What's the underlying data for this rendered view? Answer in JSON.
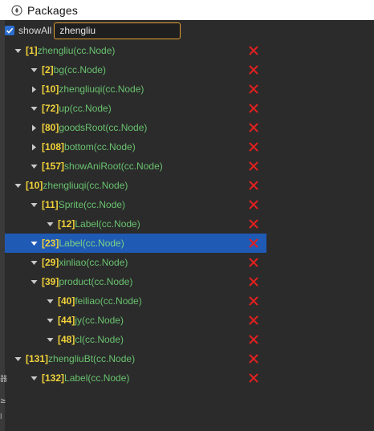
{
  "window": {
    "title": "Packages",
    "icon": "package-icon"
  },
  "toolbar": {
    "show_all_label": "showAll",
    "show_all_checked": true,
    "search_value": "zhengliu"
  },
  "tree": [
    {
      "id": "[1]",
      "name": "zhengliu(cc.Node)",
      "level": 0,
      "toggle": "expanded",
      "selected": false
    },
    {
      "id": "[2]",
      "name": "bg(cc.Node)",
      "level": 1,
      "toggle": "expanded",
      "selected": false
    },
    {
      "id": "[10]",
      "name": "zhengliuqi(cc.Node)",
      "level": 1,
      "toggle": "collapsed",
      "selected": false
    },
    {
      "id": "[72]",
      "name": "up(cc.Node)",
      "level": 1,
      "toggle": "expanded",
      "selected": false
    },
    {
      "id": "[80]",
      "name": "goodsRoot(cc.Node)",
      "level": 1,
      "toggle": "collapsed",
      "selected": false
    },
    {
      "id": "[108]",
      "name": "bottom(cc.Node)",
      "level": 1,
      "toggle": "collapsed",
      "selected": false
    },
    {
      "id": "[157]",
      "name": "showAniRoot(cc.Node)",
      "level": 1,
      "toggle": "expanded",
      "selected": false
    },
    {
      "id": "[10]",
      "name": "zhengliuqi(cc.Node)",
      "level": 0,
      "toggle": "expanded",
      "selected": false
    },
    {
      "id": "[11]",
      "name": "Sprite(cc.Node)",
      "level": 1,
      "toggle": "expanded",
      "selected": false
    },
    {
      "id": "[12]",
      "name": "Label(cc.Node)",
      "level": 2,
      "toggle": "expanded",
      "selected": false
    },
    {
      "id": "[23]",
      "name": "Label(cc.Node)",
      "level": 1,
      "toggle": "expanded",
      "selected": true
    },
    {
      "id": "[29]",
      "name": "xinliao(cc.Node)",
      "level": 1,
      "toggle": "expanded",
      "selected": false
    },
    {
      "id": "[39]",
      "name": "product(cc.Node)",
      "level": 1,
      "toggle": "expanded",
      "selected": false
    },
    {
      "id": "[40]",
      "name": "feiliao(cc.Node)",
      "level": 2,
      "toggle": "expanded",
      "selected": false
    },
    {
      "id": "[44]",
      "name": "jy(cc.Node)",
      "level": 2,
      "toggle": "expanded",
      "selected": false
    },
    {
      "id": "[48]",
      "name": "cl(cc.Node)",
      "level": 2,
      "toggle": "expanded",
      "selected": false
    },
    {
      "id": "[131]",
      "name": "zhengliuBt(cc.Node)",
      "level": 0,
      "toggle": "expanded",
      "selected": false
    },
    {
      "id": "[132]",
      "name": "Label(cc.Node)",
      "level": 1,
      "toggle": "expanded",
      "selected": false
    }
  ],
  "colors": {
    "node_id": "#f1d23a",
    "node_name": "#69c26f",
    "delete": "#e02020",
    "selection": "#1f5ab5",
    "search_border": "#e3a034"
  }
}
